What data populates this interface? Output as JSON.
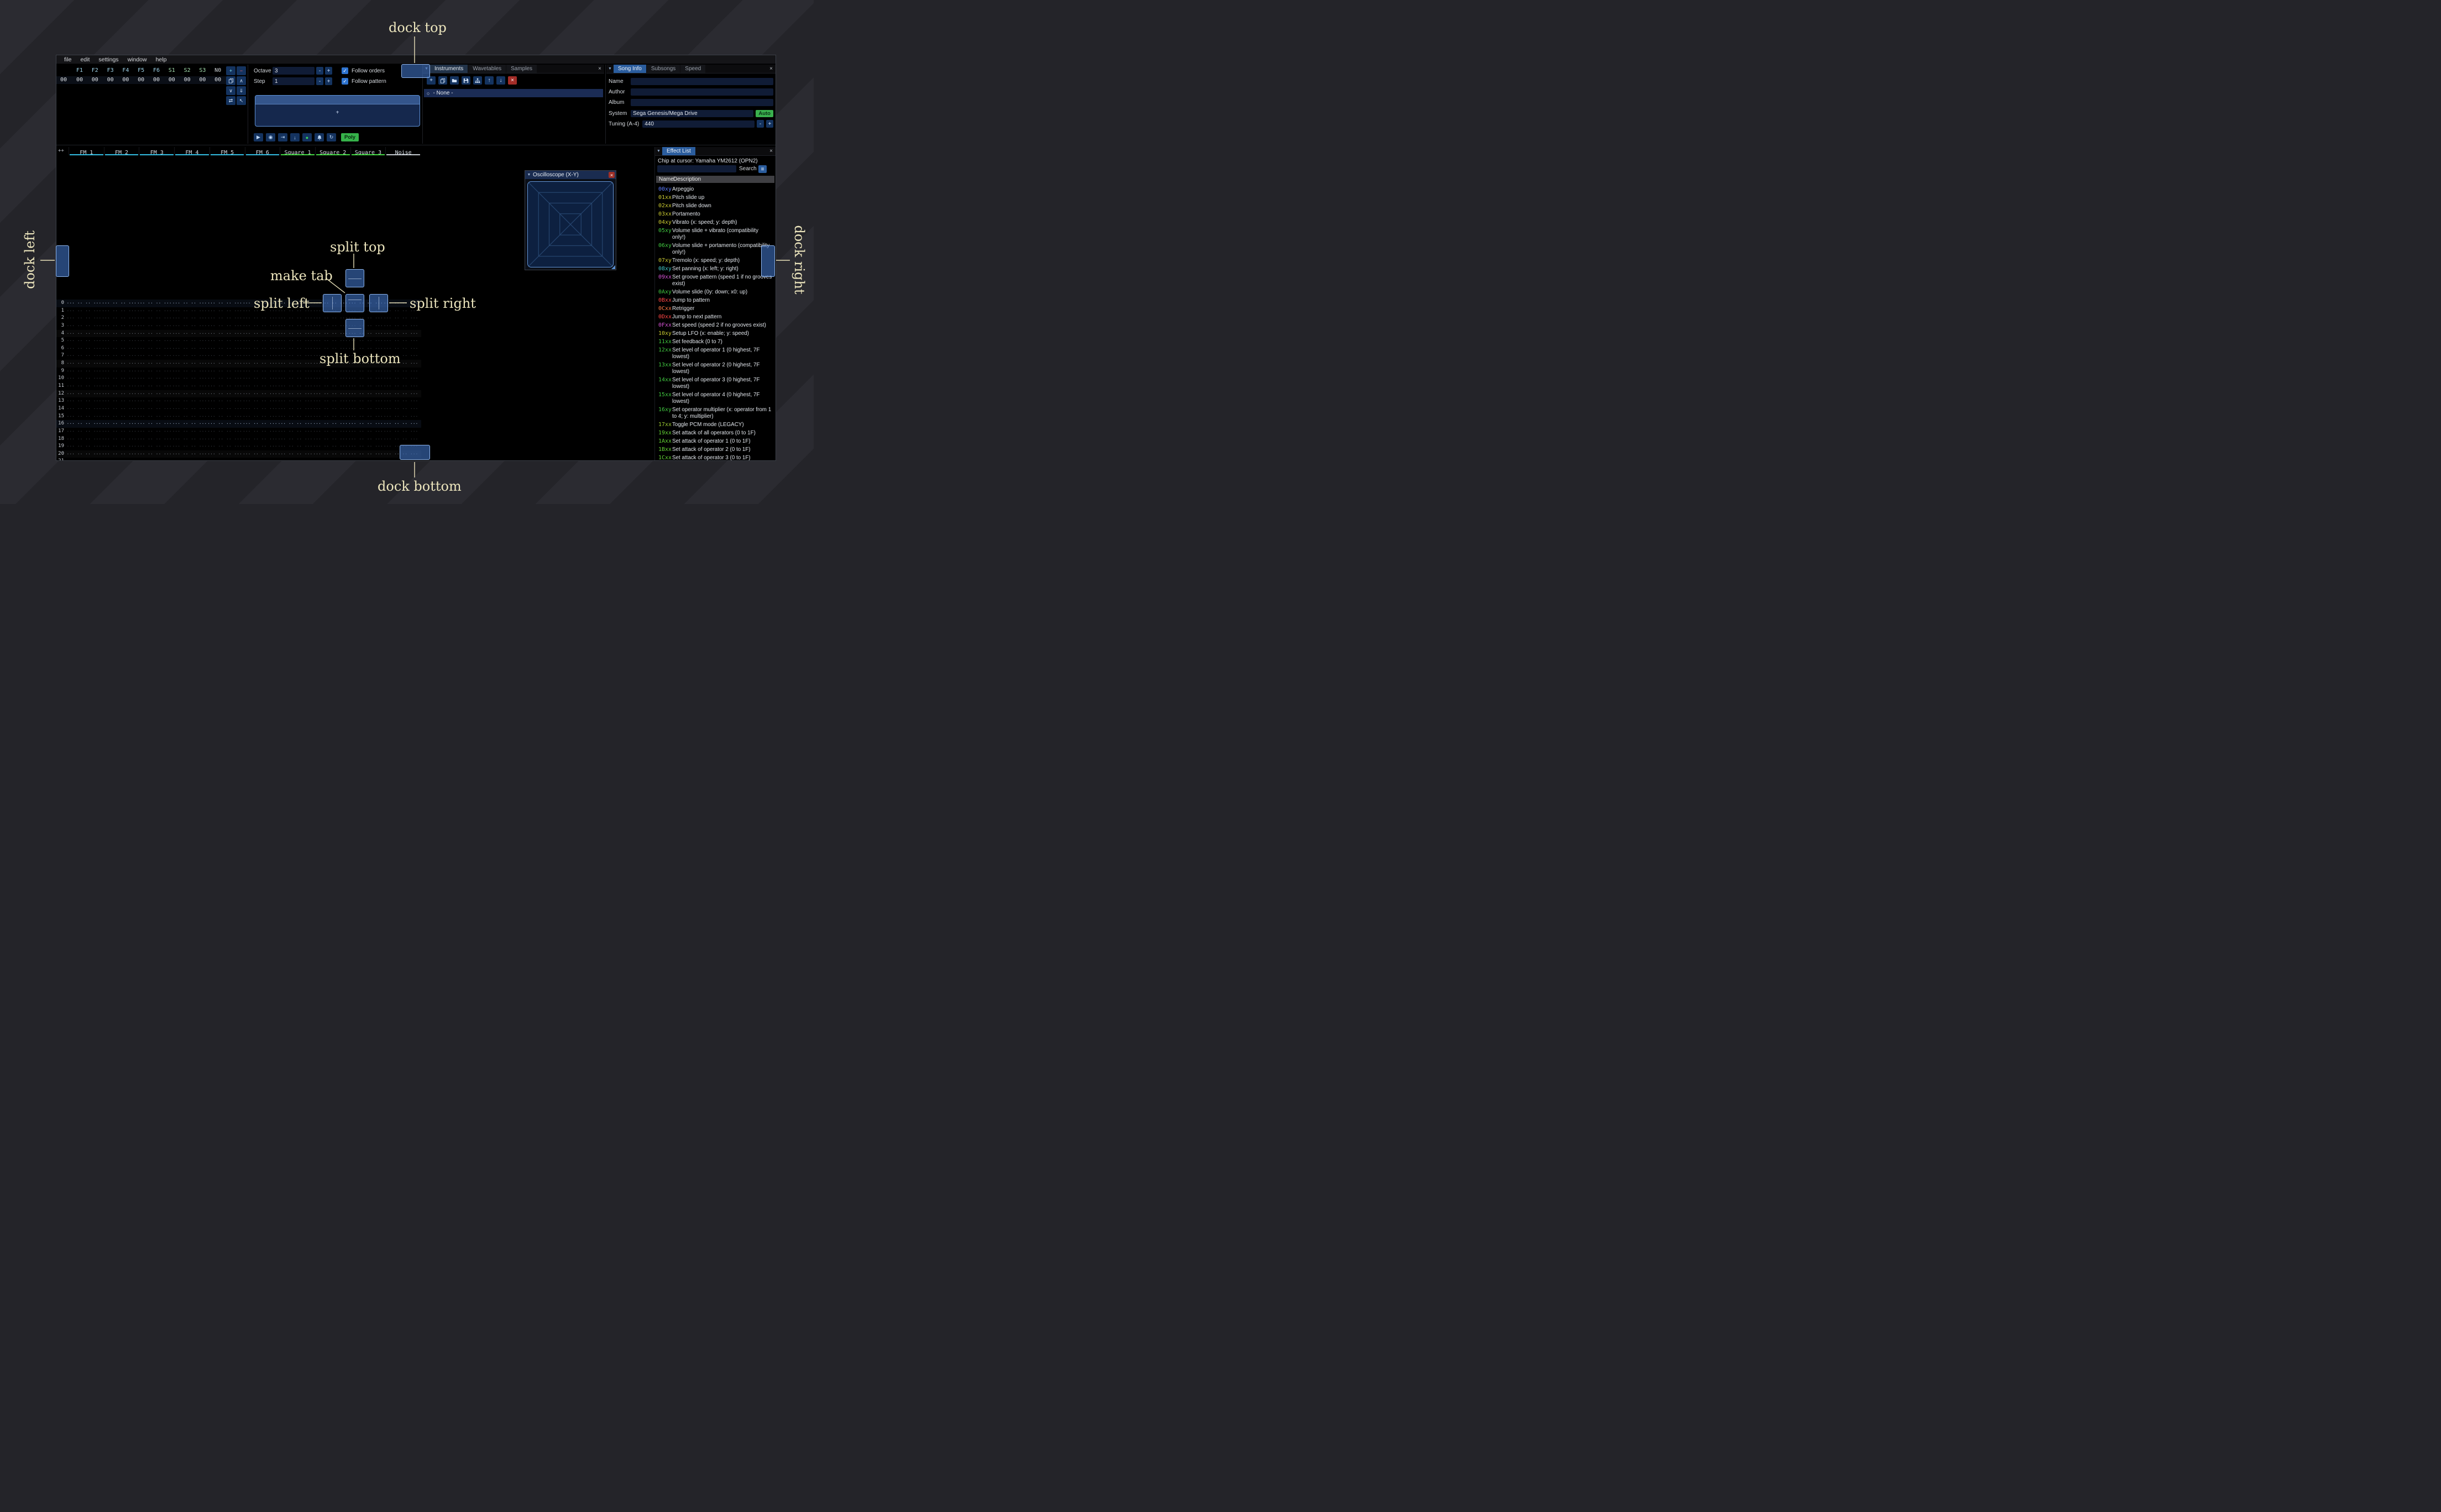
{
  "glyphs": {
    "close": "×",
    "collapse": "▼",
    "check": "✓",
    "circle": "○",
    "plus": "+",
    "minus": "-"
  },
  "window": {
    "menu_items": [
      "file",
      "edit",
      "settings",
      "window",
      "help"
    ]
  },
  "orders": {
    "row_number": "00",
    "columns": [
      {
        "label": "F1",
        "color": "#9fd4ea"
      },
      {
        "label": "F2",
        "color": "#9fd4ea"
      },
      {
        "label": "F3",
        "color": "#9fd4ea"
      },
      {
        "label": "F4",
        "color": "#9fd4ea"
      },
      {
        "label": "F5",
        "color": "#9fd4ea"
      },
      {
        "label": "F6",
        "color": "#9fd4ea"
      },
      {
        "label": "S1",
        "color": "#a5e0ae"
      },
      {
        "label": "S2",
        "color": "#a5e0ae"
      },
      {
        "label": "S3",
        "color": "#a5e0ae"
      },
      {
        "label": "N0",
        "color": "#cdd2d6"
      }
    ],
    "values": [
      "00",
      "00",
      "00",
      "00",
      "00",
      "00",
      "00",
      "00",
      "00",
      "00"
    ],
    "buttons": [
      {
        "name": "add-order-button",
        "glyph": "+",
        "color": "#7fe3f0"
      },
      {
        "name": "remove-order-button",
        "glyph": "−",
        "color": "#ff6b6b"
      },
      {
        "name": "duplicate-order-button",
        "icon": "copy"
      },
      {
        "name": "order-up-button",
        "glyph": "∧"
      },
      {
        "name": "order-down-button",
        "glyph": "∨"
      },
      {
        "name": "deep-clone-order-button",
        "glyph": "⇓"
      },
      {
        "name": "change-all-orders-button",
        "glyph": "⇄"
      },
      {
        "name": "order-edit-mode-button",
        "glyph": "↖"
      }
    ]
  },
  "play_controls": {
    "octave_label": "Octave",
    "octave_value": "3",
    "step_label": "Step",
    "step_value": "1",
    "follow_orders_label": "Follow orders",
    "follow_pattern_label": "Follow pattern",
    "poly_label": "Poly",
    "buttons": [
      {
        "name": "play-button",
        "glyph": "▶"
      },
      {
        "name": "play-pattern-button",
        "glyph": "◉"
      },
      {
        "name": "play-row-button",
        "glyph": "⇥"
      },
      {
        "name": "step-row-button",
        "glyph": "↓"
      },
      {
        "name": "edit-record-toggle-button",
        "glyph": "●",
        "color": "#3ad45c"
      },
      {
        "name": "metronome-button",
        "icon": "bell"
      },
      {
        "name": "repeat-pattern-button",
        "glyph": "↻"
      }
    ]
  },
  "instruments": {
    "tabs": [
      {
        "label": "Instruments",
        "active": true
      },
      {
        "label": "Wavetables",
        "active": false
      },
      {
        "label": "Samples",
        "active": false
      }
    ],
    "toolbar": [
      {
        "name": "add-instrument-button",
        "glyph": "+"
      },
      {
        "name": "duplicate-instrument-button",
        "icon": "copy"
      },
      {
        "name": "open-instrument-button",
        "icon": "folder"
      },
      {
        "name": "save-instrument-button",
        "icon": "floppy"
      },
      {
        "name": "instrument-folders-button",
        "icon": "sitemap"
      },
      {
        "name": "move-instrument-up-button",
        "glyph": "↑"
      },
      {
        "name": "move-instrument-down-button",
        "glyph": "↓"
      },
      {
        "name": "delete-instrument-button",
        "glyph": "×",
        "danger": true
      }
    ],
    "list": [
      {
        "label": "- None -",
        "selected": true
      }
    ]
  },
  "song_info": {
    "tabs": [
      {
        "label": "Song Info",
        "active": true
      },
      {
        "label": "Subsongs",
        "active": false
      },
      {
        "label": "Speed",
        "active": false
      }
    ],
    "fields": [
      {
        "label": "Name",
        "value": ""
      },
      {
        "label": "Author",
        "value": ""
      },
      {
        "label": "Album",
        "value": ""
      }
    ],
    "system_label": "System",
    "system_value": "Sega Genesis/Mega Drive",
    "auto_label": "Auto",
    "tuning_label": "Tuning (A-4)",
    "tuning_value": "440"
  },
  "pattern": {
    "corner_label": "++",
    "channels": [
      {
        "name": "FM 1",
        "color": "#33bde2"
      },
      {
        "name": "FM 2",
        "color": "#33bde2"
      },
      {
        "name": "FM 3",
        "color": "#33bde2"
      },
      {
        "name": "FM 4",
        "color": "#33bde2"
      },
      {
        "name": "FM 5",
        "color": "#33bde2"
      },
      {
        "name": "FM 6",
        "color": "#33bde2"
      },
      {
        "name": "Square 1",
        "color": "#43d643"
      },
      {
        "name": "Square 2",
        "color": "#43d643"
      },
      {
        "name": "Square 3",
        "color": "#43d643"
      },
      {
        "name": "Noise",
        "color": "#c4cad0"
      }
    ],
    "row_count": 22,
    "empty_cell": "··· ·· ·· ···",
    "highlight1_every": 4,
    "highlight2_every": 16
  },
  "oscilloscope": {
    "title": "Oscilloscope (X-Y)"
  },
  "effect_list": {
    "title": "Effect List",
    "chip_line": "Chip at cursor: Yamaha YM2612 (OPN2)",
    "search_label": "Search",
    "search_value": "",
    "columns": [
      "Name",
      "Description"
    ],
    "effects": [
      {
        "name": "00xy",
        "color": "#5c7cff",
        "desc": "Arpeggio"
      },
      {
        "name": "01xx",
        "color": "#c9c931",
        "desc": "Pitch slide up"
      },
      {
        "name": "02xx",
        "color": "#c9c931",
        "desc": "Pitch slide down"
      },
      {
        "name": "03xx",
        "color": "#c9c931",
        "desc": "Portamento"
      },
      {
        "name": "04xy",
        "color": "#c9c931",
        "desc": "Vibrato (x: speed; y: depth)"
      },
      {
        "name": "05xy",
        "color": "#41c941",
        "desc": "Volume slide + vibrato (compatibility only!)"
      },
      {
        "name": "06xy",
        "color": "#41c941",
        "desc": "Volume slide + portamento (compatibility only!)"
      },
      {
        "name": "07xy",
        "color": "#c9c931",
        "desc": "Tremolo (x: speed; y: depth)"
      },
      {
        "name": "08xy",
        "color": "#41c9c9",
        "desc": "Set panning (x: left; y: right)"
      },
      {
        "name": "09xx",
        "color": "#d553d5",
        "desc": "Set groove pattern (speed 1 if no grooves exist)"
      },
      {
        "name": "0Axy",
        "color": "#41c941",
        "desc": "Volume slide (0y: down; x0: up)"
      },
      {
        "name": "0Bxx",
        "color": "#ff4545",
        "desc": "Jump to pattern"
      },
      {
        "name": "0Cxx",
        "color": "#ff7a45",
        "desc": "Retrigger"
      },
      {
        "name": "0Dxx",
        "color": "#ff4545",
        "desc": "Jump to next pattern"
      },
      {
        "name": "0Fxx",
        "color": "#d553d5",
        "desc": "Set speed (speed 2 if no grooves exist)"
      },
      {
        "name": "10xy",
        "color": "#c9c931",
        "desc": "Setup LFO (x: enable; y: speed)"
      },
      {
        "name": "11xx",
        "color": "#41c941",
        "desc": "Set feedback (0 to 7)"
      },
      {
        "name": "12xx",
        "color": "#41c941",
        "desc": "Set level of operator 1 (0 highest, 7F lowest)"
      },
      {
        "name": "13xx",
        "color": "#41c941",
        "desc": "Set level of operator 2 (0 highest, 7F lowest)"
      },
      {
        "name": "14xx",
        "color": "#41c941",
        "desc": "Set level of operator 3 (0 highest, 7F lowest)"
      },
      {
        "name": "15xx",
        "color": "#41c941",
        "desc": "Set level of operator 4 (0 highest, 7F lowest)"
      },
      {
        "name": "16xy",
        "color": "#41c941",
        "desc": "Set operator multiplier (x: operator from 1 to 4; y: multiplier)"
      },
      {
        "name": "17xx",
        "color": "#9ac931",
        "desc": "Toggle PCM mode (LEGACY)"
      },
      {
        "name": "19xx",
        "color": "#63d435",
        "desc": "Set attack of all operators (0 to 1F)"
      },
      {
        "name": "1Axx",
        "color": "#63d435",
        "desc": "Set attack of operator 1 (0 to 1F)"
      },
      {
        "name": "1Bxx",
        "color": "#63d435",
        "desc": "Set attack of operator 2 (0 to 1F)"
      },
      {
        "name": "1Cxx",
        "color": "#63d435",
        "desc": "Set attack of operator 3 (0 to 1F)"
      }
    ]
  },
  "overlay": {
    "labels": {
      "dock_top": "dock top",
      "dock_bottom": "dock bottom",
      "dock_left": "dock left",
      "dock_right": "dock right",
      "split_top": "split top",
      "split_bottom": "split bottom",
      "split_left": "split left",
      "split_right": "split right",
      "make_tab": "make tab"
    },
    "label_color": "#ece5bd",
    "indicator_fill": "rgba(62,112,190,0.62)",
    "indicator_border": "#8fb6ee"
  }
}
